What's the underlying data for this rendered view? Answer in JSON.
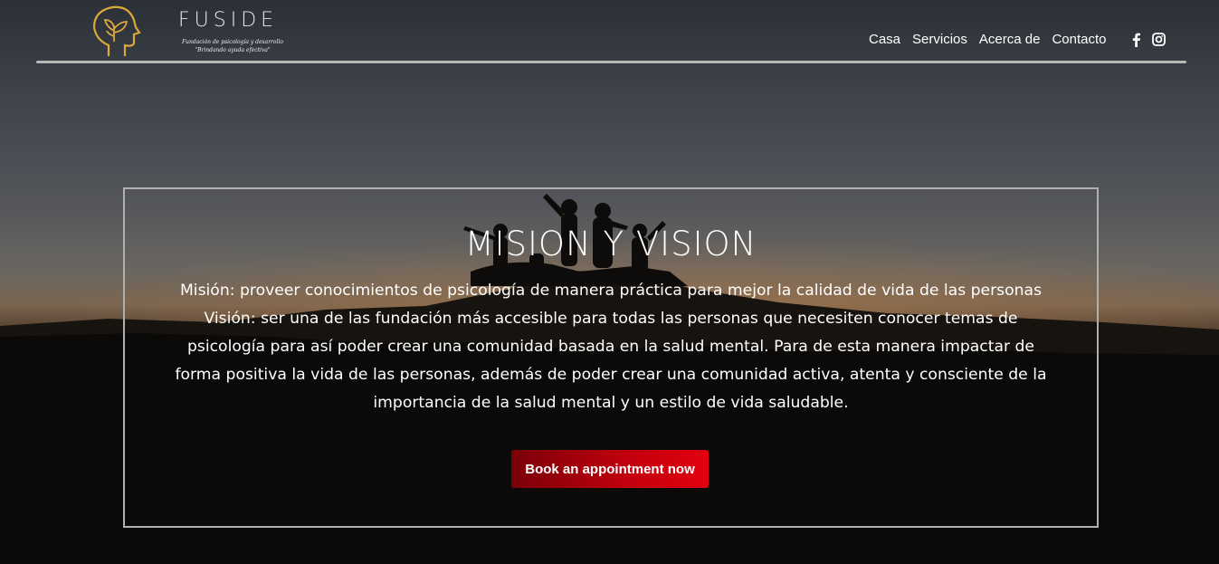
{
  "header": {
    "brand_name": "FUSIDE",
    "tagline_line1": "Fundación de psicología y desarrollo",
    "tagline_line2": "\"Brindando ayuda efectiva\"",
    "logo_icon": "head-with-plant-icon",
    "nav": [
      {
        "label": "Casa"
      },
      {
        "label": "Servicios"
      },
      {
        "label": "Acerca de"
      },
      {
        "label": "Contacto"
      }
    ],
    "social": [
      {
        "icon": "facebook-icon"
      },
      {
        "icon": "instagram-icon"
      }
    ]
  },
  "hero": {
    "title": "MISION Y VISION",
    "text": "Misión: proveer conocimientos de psicología de manera práctica para mejor la calidad de vida de las personas Visión: ser una de las fundación más accesible para todas las personas que necesiten conocer temas de psicología para así poder crear una comunidad basada en la salud mental. Para de esta manera impactar de forma positiva la vida de las personas, además de poder crear una comunidad activa, atenta y consciente de la importancia de la salud mental y un estilo de vida saludable.",
    "cta_label": "Book an appointment now"
  },
  "colors": {
    "cta_start": "#7a0008",
    "cta_end": "#e3000f",
    "logo_gold": "#d9a93a",
    "frame_border": "#b0b0b0"
  }
}
